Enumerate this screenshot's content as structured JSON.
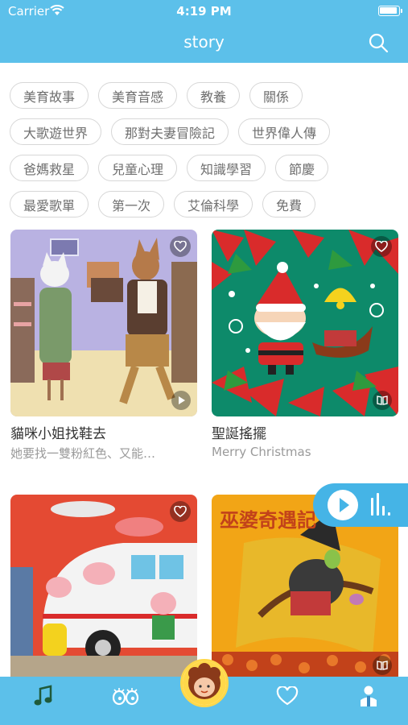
{
  "status_bar": {
    "carrier": "Carrier",
    "time": "4:19 PM"
  },
  "nav": {
    "title": "story"
  },
  "tag_rows": [
    [
      "美育故事",
      "美育音感",
      "教養",
      "關係"
    ],
    [
      "大歌遊世界",
      "那對夫妻冒險記",
      "世界偉人傳"
    ],
    [
      "爸媽救星",
      "兒童心理",
      "知識學習",
      "節慶"
    ],
    [
      "最愛歌單",
      "第一次",
      "艾倫科學",
      "免費"
    ]
  ],
  "stories": [
    {
      "title": "貓咪小姐找鞋去",
      "subtitle": "她要找一雙粉紅色、又能…"
    },
    {
      "title": "聖誕搖擺",
      "subtitle": "Merry Christmas"
    },
    {
      "title": "",
      "subtitle": ""
    },
    {
      "title": "",
      "subtitle": "",
      "cover_text": "巫婆奇遇記"
    }
  ],
  "colors": {
    "accent": "#5cc0ea",
    "tag_border": "#d7d7d7",
    "avatar_ring": "#ffd84a"
  },
  "icons": {
    "tab_music": "music-note-icon",
    "tab_discover": "eyes-icon",
    "tab_center": "avatar",
    "tab_favorites": "heart-icon",
    "tab_profile": "person-icon"
  }
}
